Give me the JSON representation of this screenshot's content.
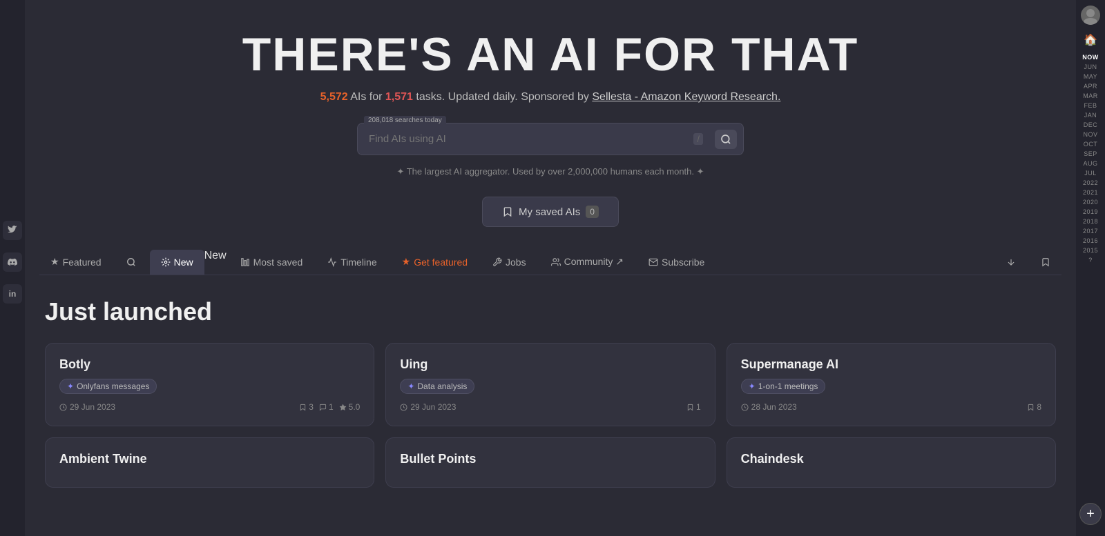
{
  "hero": {
    "title": "THERE'S AN AI FOR THAT",
    "subtitle_ai_count": "5,572",
    "subtitle_task_count": "1,571",
    "subtitle_middle": "AIs for",
    "subtitle_tasks": "tasks. Updated daily. Sponsored by",
    "sponsor_text": "Sellesta - Amazon Keyword Research.",
    "search_placeholder": "Find AIs using AI",
    "search_count_label": "208,018 searches today",
    "tagline": "✦ The largest AI aggregator. Used by over 2,000,000 humans each month. ✦",
    "saved_button_label": "My saved AIs",
    "saved_count": "0"
  },
  "nav": {
    "tabs": [
      {
        "id": "featured",
        "label": "Featured",
        "icon": "★",
        "active": false,
        "badge": null
      },
      {
        "id": "search",
        "label": "",
        "icon": "🔍",
        "active": false,
        "badge": null
      },
      {
        "id": "new",
        "label": "New",
        "icon": "⚙",
        "active": true,
        "badge": "New"
      },
      {
        "id": "most-saved",
        "label": "Most saved",
        "icon": "📊",
        "active": false,
        "badge": null
      },
      {
        "id": "timeline",
        "label": "Timeline",
        "icon": "〰",
        "active": false,
        "badge": null
      },
      {
        "id": "get-featured",
        "label": "Get featured",
        "icon": "★",
        "active": false,
        "badge": null,
        "highlight": true
      },
      {
        "id": "jobs",
        "label": "Jobs",
        "icon": "🔧",
        "active": false,
        "badge": null
      },
      {
        "id": "community",
        "label": "Community ↗",
        "icon": "👥",
        "active": false,
        "badge": null
      },
      {
        "id": "subscribe",
        "label": "Subscribe",
        "icon": "✉",
        "active": false,
        "badge": null
      },
      {
        "id": "sort",
        "label": "",
        "icon": "↕",
        "active": false,
        "badge": null
      },
      {
        "id": "bookmark",
        "label": "",
        "icon": "🔖",
        "active": false,
        "badge": null
      }
    ]
  },
  "section": {
    "title": "Just launched"
  },
  "cards": [
    {
      "id": "botly",
      "title": "Botly",
      "tag": "Onlyfans messages",
      "date": "29 Jun 2023",
      "stats": [
        {
          "icon": "bookmark",
          "value": "3"
        },
        {
          "icon": "comment",
          "value": "1"
        },
        {
          "icon": "star",
          "value": "5.0"
        }
      ]
    },
    {
      "id": "uing",
      "title": "Uing",
      "tag": "Data analysis",
      "date": "29 Jun 2023",
      "stats": [
        {
          "icon": "bookmark",
          "value": "1"
        }
      ]
    },
    {
      "id": "supermanage-ai",
      "title": "Supermanage AI",
      "tag": "1-on-1 meetings",
      "date": "28 Jun 2023",
      "stats": [
        {
          "icon": "bookmark",
          "value": "8"
        }
      ]
    }
  ],
  "partial_cards": [
    {
      "id": "ambient-twine",
      "title": "Ambient Twine"
    },
    {
      "id": "bullet-points",
      "title": "Bullet Points"
    },
    {
      "id": "chaindesk",
      "title": "Chaindesk"
    }
  ],
  "right_sidebar": {
    "time_labels": [
      "NOW",
      "JUN",
      "MAY",
      "APR",
      "MAR",
      "FEB",
      "JAN",
      "DEC",
      "NOV",
      "OCT",
      "SEP",
      "AUG",
      "JUL",
      "2022",
      "2021",
      "2020",
      "2019",
      "2018",
      "2017",
      "2016",
      "2015",
      "?"
    ],
    "add_label": "+"
  },
  "left_sidebar": {
    "social_icons": [
      {
        "id": "twitter",
        "symbol": "🐦"
      },
      {
        "id": "discord",
        "symbol": "💬"
      },
      {
        "id": "linkedin",
        "symbol": "in"
      }
    ]
  }
}
